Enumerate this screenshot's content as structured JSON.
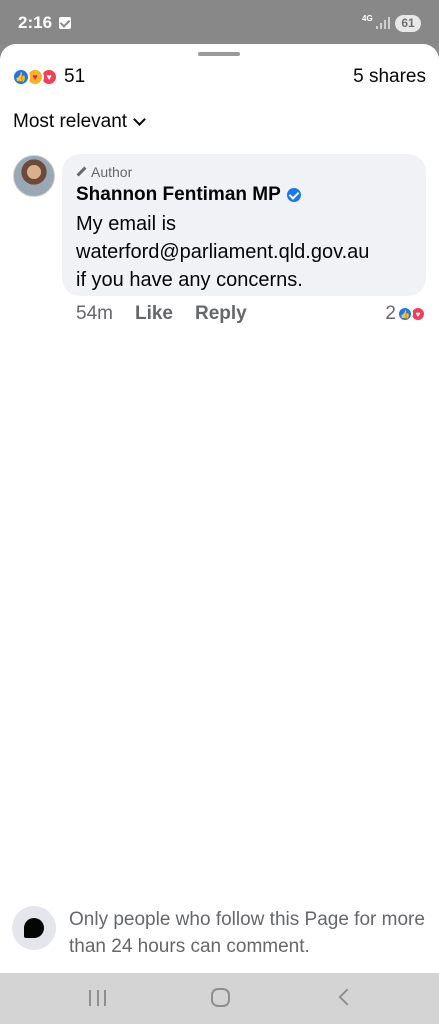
{
  "status_bar": {
    "time": "2:16",
    "network": "4G",
    "battery": "61"
  },
  "post": {
    "reactions_count": "51",
    "shares": "5 shares",
    "reaction_icons": [
      "like-icon",
      "care-icon",
      "love-icon"
    ]
  },
  "sort": {
    "label": "Most relevant"
  },
  "comment": {
    "author_tag": "Author",
    "author_name": "Shannon Fentiman MP",
    "text": "My email is\nwaterford@parliament.qld.gov.au\nif you have any concerns.",
    "time": "54m",
    "like_label": "Like",
    "reply_label": "Reply",
    "reaction_count": "2",
    "reaction_icons": [
      "like-icon",
      "love-icon"
    ]
  },
  "notice": {
    "text": "Only people who follow this Page for more than 24 hours can comment."
  },
  "colors": {
    "accent": "#1877f2",
    "love": "#f33e58",
    "care": "#f7b125",
    "secondary_text": "#65676b",
    "bubble": "#f0f2f5"
  }
}
